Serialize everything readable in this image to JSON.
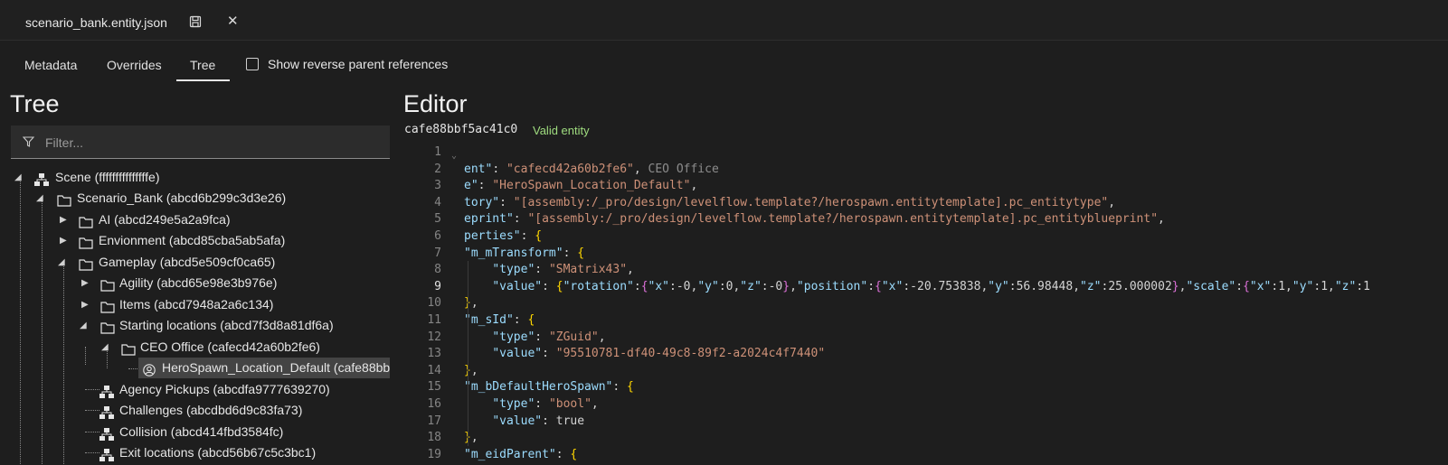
{
  "file_tab": {
    "name": "scenario_bank.entity.json"
  },
  "view_tabs": [
    "Metadata",
    "Overrides",
    "Tree"
  ],
  "active_view_tab": "Tree",
  "reverse_refs": {
    "label": "Show reverse parent references",
    "checked": false
  },
  "tree": {
    "title": "Tree",
    "filter_placeholder": "Filter...",
    "nodes": [
      {
        "label": "Scene (fffffffffffffffe)",
        "icon": "entity-icon",
        "expanded": true
      },
      {
        "label": "Scenario_Bank (abcd6b299c3d3e26)",
        "icon": "folder-icon",
        "expanded": true
      },
      {
        "label": "AI (abcd249e5a2a9fca)",
        "icon": "folder-icon",
        "expanded": false
      },
      {
        "label": "Envionment (abcd85cba5ab5afa)",
        "icon": "folder-icon",
        "expanded": false
      },
      {
        "label": "Gameplay (abcd5e509cf0ca65)",
        "icon": "folder-icon",
        "expanded": true
      },
      {
        "label": "Agility (abcd65e98e3b976e)",
        "icon": "folder-icon",
        "expanded": false
      },
      {
        "label": "Items (abcd7948a2a6c134)",
        "icon": "folder-icon",
        "expanded": false
      },
      {
        "label": "Starting locations (abcd7f3d8a81df6a)",
        "icon": "folder-icon",
        "expanded": true
      },
      {
        "label": "CEO Office (cafecd42a60b2fe6)",
        "icon": "folder-icon",
        "expanded": true
      },
      {
        "label": "HeroSpawn_Location_Default (cafe88bbf5ac41c0)",
        "icon": "person-icon",
        "selected": true
      },
      {
        "label": "Agency Pickups (abcdfa9777639270)",
        "icon": "entity-icon"
      },
      {
        "label": "Challenges (abcdbd6d9c83fa73)",
        "icon": "entity-icon"
      },
      {
        "label": "Collision (abcd414fbd3584fc)",
        "icon": "entity-icon"
      },
      {
        "label": "Exit locations (abcd56b67c5c3bc1)",
        "icon": "entity-icon"
      }
    ]
  },
  "editor": {
    "title": "Editor",
    "entity_id": "cafe88bbf5ac41c0",
    "status": "Valid entity",
    "current_line": 9,
    "lines": [
      "",
      "ent\": \"cafecd42a60b2fe6\", CEO Office",
      "e\": \"HeroSpawn_Location_Default\",",
      "tory\": \"[assembly:/_pro/design/levelflow.template?/herospawn.entitytemplate].pc_entitytype\",",
      "eprint\": \"[assembly:/_pro/design/levelflow.template?/herospawn.entitytemplate].pc_entityblueprint\",",
      "perties\": {",
      "\"m_mTransform\": {",
      "    \"type\": \"SMatrix43\",",
      "    \"value\": {\"rotation\":{\"x\":-0,\"y\":0,\"z\":-0},\"position\":{\"x\":-20.753838,\"y\":56.98448,\"z\":25.000002},\"scale\":{\"x\":1,\"y\":1,\"z\":1",
      "},",
      "\"m_sId\": {",
      "    \"type\": \"ZGuid\",",
      "    \"value\": \"95510781-df40-49c8-89f2-a2024c4f7440\"",
      "},",
      "\"m_bDefaultHeroSpawn\": {",
      "    \"type\": \"bool\",",
      "    \"value\": true",
      "},",
      "\"m_eidParent\": {"
    ]
  },
  "colors": {
    "key": "#9cdcfe",
    "string": "#ce9178",
    "keyword": "#569cd6",
    "valid": "#9fdc7f",
    "comment": "#8c8c8c"
  }
}
